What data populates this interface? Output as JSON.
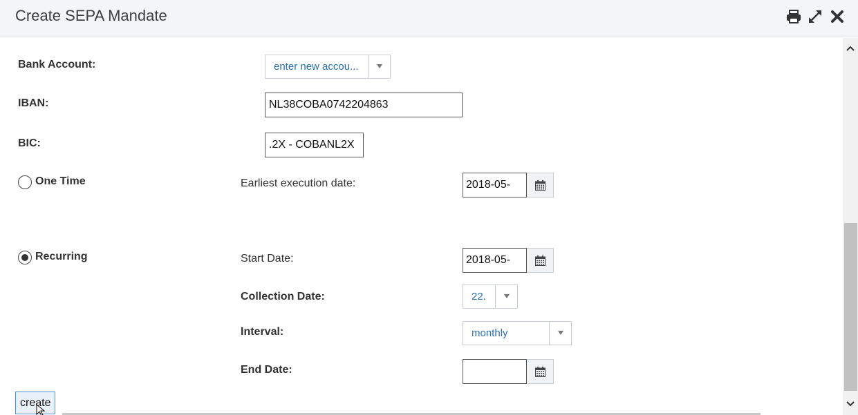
{
  "dialog": {
    "title": "Create SEPA Mandate",
    "icons": [
      "printer-icon",
      "expand-icon",
      "close-icon"
    ]
  },
  "form": {
    "bank_account": {
      "label": "Bank Account:",
      "value": "enter new accou..."
    },
    "iban": {
      "label": "IBAN:",
      "value": "NL38COBA0742204863"
    },
    "bic": {
      "label": "BIC:",
      "value": ".2X - COBANL2X"
    },
    "one_time": {
      "label": "One Time",
      "selected": false,
      "earliest_label": "Earliest execution date:",
      "earliest_value": "2018-05-"
    },
    "recurring": {
      "label": "Recurring",
      "selected": true,
      "start_label": "Start Date:",
      "start_value": "2018-05-",
      "collection_label": "Collection Date:",
      "collection_value": "22.",
      "interval_label": "Interval:",
      "interval_value": "monthly",
      "end_label": "End Date:",
      "end_value": ""
    },
    "create_label": "create"
  },
  "colors": {
    "link_blue": "#2a6fb0",
    "header_bg": "#f4f5f7",
    "button_border": "#4a90d9"
  }
}
